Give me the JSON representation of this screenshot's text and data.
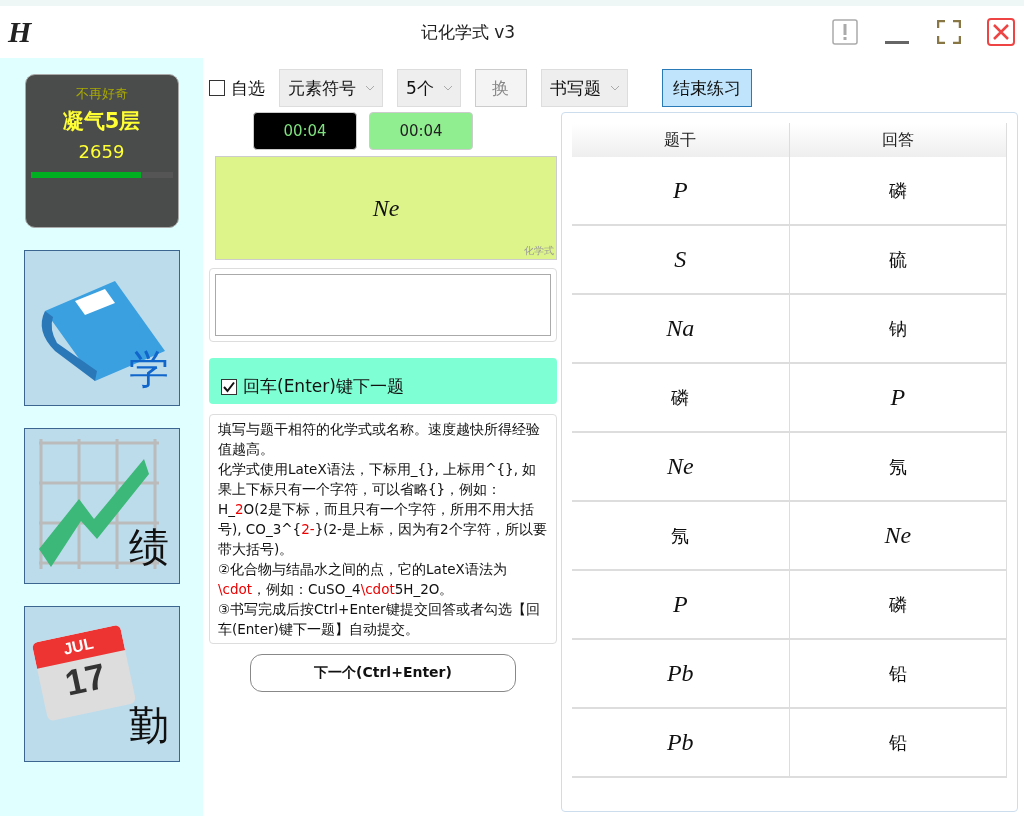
{
  "window": {
    "logo": "H",
    "title": "记化学式 v3"
  },
  "profile": {
    "motto": "不再好奇",
    "rank": "凝气5层",
    "score": "2659",
    "level": 0.78
  },
  "nav": [
    {
      "kind": "book",
      "label": "学"
    },
    {
      "kind": "chart",
      "label": "绩"
    },
    {
      "kind": "calendar",
      "label": "勤",
      "month": "JUL",
      "day": "17"
    }
  ],
  "toolbar": {
    "self_select": {
      "label": "自选",
      "checked": false
    },
    "dropdowns": [
      "元素符号",
      "5个"
    ],
    "swap_button": "换",
    "mode": "书写题",
    "end_button": "结束练习"
  },
  "timers": [
    {
      "kind": "dark",
      "text": "00:04"
    },
    {
      "kind": "light",
      "text": "00:04"
    }
  ],
  "question": {
    "formula": "Ne",
    "tag": "化学式"
  },
  "enter_next": {
    "label": "回车(Enter)键下一题",
    "checked": true
  },
  "help": [
    [
      {
        "text": "填写与题干相符的化学式或名称。速度越快所得经验值越高。",
        "highlight": false
      }
    ],
    [
      {
        "text": "化学式使用LateX语法，下标用_{}, 上标用^{}, 如果上下标只有一个字符，可以省略{}，例如：H_",
        "highlight": false
      },
      {
        "text": "2",
        "highlight": true
      },
      {
        "text": "O(2是下标，而且只有一个字符，所用不用大括号), CO_3^{",
        "highlight": false
      },
      {
        "text": "2-",
        "highlight": true
      },
      {
        "text": "}(2-是上标，因为有2个字符，所以要带大括号)。",
        "highlight": false
      }
    ],
    [
      {
        "text": "②化合物与结晶水之间的点，它的LateX语法为",
        "highlight": false
      },
      {
        "text": "\\cdot",
        "highlight": true
      },
      {
        "text": "，例如：CuSO_4",
        "highlight": false
      },
      {
        "text": "\\cdot",
        "highlight": true
      },
      {
        "text": "5H_2O。",
        "highlight": false
      }
    ],
    [
      {
        "text": "③书写完成后按Ctrl+Enter键提交回答或者勾选【回车(Enter)键下一题】自动提交。",
        "highlight": false
      }
    ]
  ],
  "next_button": "下一个(Ctrl+Enter)",
  "table": {
    "columns": [
      "题干",
      "回答"
    ],
    "rows": [
      [
        {
          "kind": "formula",
          "text": "P"
        },
        {
          "kind": "name",
          "text": "磷"
        }
      ],
      [
        {
          "kind": "formula",
          "text": "S"
        },
        {
          "kind": "name",
          "text": "硫"
        }
      ],
      [
        {
          "kind": "formula",
          "text": "Na"
        },
        {
          "kind": "name",
          "text": "钠"
        }
      ],
      [
        {
          "kind": "name",
          "text": "磷"
        },
        {
          "kind": "formula",
          "text": "P"
        }
      ],
      [
        {
          "kind": "formula",
          "text": "Ne"
        },
        {
          "kind": "name",
          "text": "氖"
        }
      ],
      [
        {
          "kind": "name",
          "text": "氖"
        },
        {
          "kind": "formula",
          "text": "Ne"
        }
      ],
      [
        {
          "kind": "formula",
          "text": "P"
        },
        {
          "kind": "name",
          "text": "磷"
        }
      ],
      [
        {
          "kind": "formula",
          "text": "Pb"
        },
        {
          "kind": "name",
          "text": "铅"
        }
      ],
      [
        {
          "kind": "formula",
          "text": "Pb"
        },
        {
          "kind": "name",
          "text": "铅"
        }
      ]
    ]
  }
}
